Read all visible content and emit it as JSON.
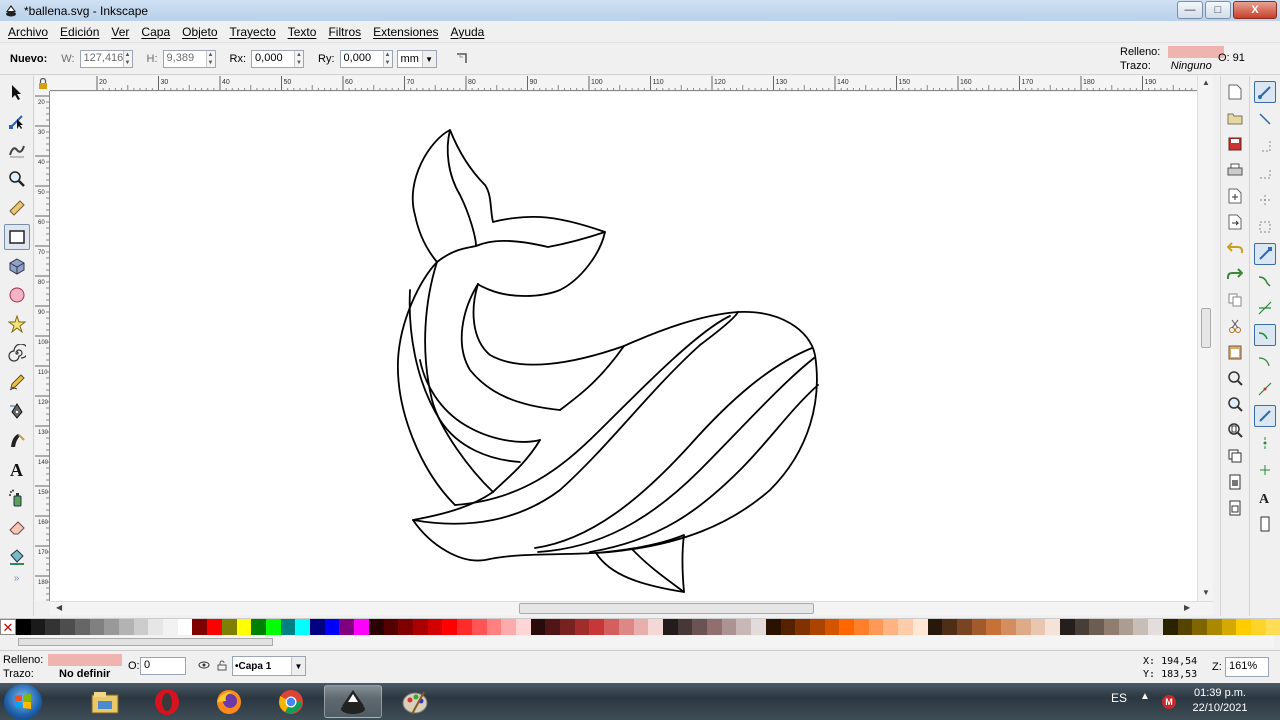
{
  "window": {
    "title": "*ballena.svg - Inkscape",
    "controls": {
      "minimize": "—",
      "maximize": "□",
      "close": "X"
    }
  },
  "menu": [
    "Archivo",
    "Edición",
    "Ver",
    "Capa",
    "Objeto",
    "Trayecto",
    "Texto",
    "Filtros",
    "Extensiones",
    "Ayuda"
  ],
  "tool_controls": {
    "mode_label": "Nuevo:",
    "w_label": "W:",
    "w_value": "127,416",
    "h_label": "H:",
    "h_value": "9,389",
    "rx_label": "Rx:",
    "rx_value": "0,000",
    "ry_label": "Ry:",
    "ry_value": "0,000",
    "unit": "mm"
  },
  "fill_stroke_top": {
    "fill_label": "Relleno:",
    "stroke_label": "Trazo:",
    "stroke_value": "Ninguno",
    "opacity": "O: 91",
    "fill_color": "#f0b4b0"
  },
  "toolbox": [
    "selector-tool-icon",
    "node-tool-icon",
    "tweak-tool-icon",
    "zoom-tool-icon",
    "measure-tool-icon",
    "rect-tool-icon",
    "3dbox-tool-icon",
    "ellipse-tool-icon",
    "star-tool-icon",
    "spiral-tool-icon",
    "pencil-tool-icon",
    "pen-tool-icon",
    "calligraphy-tool-icon",
    "text-tool-icon",
    "spray-tool-icon",
    "eraser-tool-icon",
    "paint-bucket-tool-icon"
  ],
  "active_tool": "rect-tool-icon",
  "ruler_top_labels": [
    "20",
    "30",
    "40",
    "50",
    "60",
    "70",
    "80",
    "90",
    "100",
    "110",
    "120",
    "130",
    "140",
    "150",
    "160",
    "170",
    "180",
    "190"
  ],
  "ruler_left_labels": [
    "20",
    "30",
    "40",
    "50",
    "60",
    "70",
    "80",
    "90",
    "100",
    "110",
    "120",
    "130",
    "140",
    "150",
    "160",
    "170",
    "180"
  ],
  "palette_colors": [
    "#000000",
    "#1a1a1a",
    "#333333",
    "#4d4d4d",
    "#666666",
    "#808080",
    "#999999",
    "#b3b3b3",
    "#cccccc",
    "#e6e6e6",
    "#f2f2f2",
    "#ffffff",
    "#800000",
    "#ff0000",
    "#808000",
    "#ffff00",
    "#008000",
    "#00ff00",
    "#008080",
    "#00ffff",
    "#000080",
    "#0000ff",
    "#800080",
    "#ff00ff",
    "#2b0000",
    "#550000",
    "#800000",
    "#aa0000",
    "#d40000",
    "#ff0000",
    "#ff2a2a",
    "#ff5555",
    "#ff8080",
    "#ffaaaa",
    "#ffd5d5",
    "#280b0b",
    "#501616",
    "#782121",
    "#a02c2c",
    "#c83737",
    "#d35f5f",
    "#de8787",
    "#e9afaf",
    "#f4d7d7",
    "#241c1c",
    "#483737",
    "#6c5353",
    "#916f6f",
    "#ac9393",
    "#c8b7b7",
    "#e3dbdb",
    "#2b1100",
    "#552200",
    "#803300",
    "#aa4400",
    "#d45500",
    "#ff6600",
    "#ff7f2a",
    "#ff9955",
    "#ffb380",
    "#ffccaa",
    "#ffe6d5",
    "#28170b",
    "#502d16",
    "#784421",
    "#a05a2c",
    "#c87137",
    "#d38d5f",
    "#deaa87",
    "#e9c6af",
    "#f4e3d7",
    "#241f1c",
    "#483e37",
    "#6c5d53",
    "#917c6f",
    "#ac9d93",
    "#c8beb7",
    "#e3dedb",
    "#2b2200",
    "#554400",
    "#806600",
    "#aa8800",
    "#d4aa00",
    "#ffcc00",
    "#ffd42a",
    "#ffdd55"
  ],
  "status": {
    "fill_label": "Relleno:",
    "stroke_label": "Trazo:",
    "stroke_value": "No definir",
    "opacity_label": "O:",
    "opacity_value": "0",
    "layer": "•Capa 1",
    "x_label": "X:",
    "x_value": "194,54",
    "y_label": "Y:",
    "y_value": "183,53",
    "zoom_label": "Z:",
    "zoom_value": "161%"
  },
  "taskbar": {
    "apps": [
      "explorer-icon",
      "opera-icon",
      "firefox-icon",
      "chrome-icon",
      "inkscape-icon",
      "paint-icon"
    ],
    "active_app": "inkscape-icon",
    "language": "ES",
    "time": "01:39 p.m.",
    "date": "22/10/2021"
  }
}
